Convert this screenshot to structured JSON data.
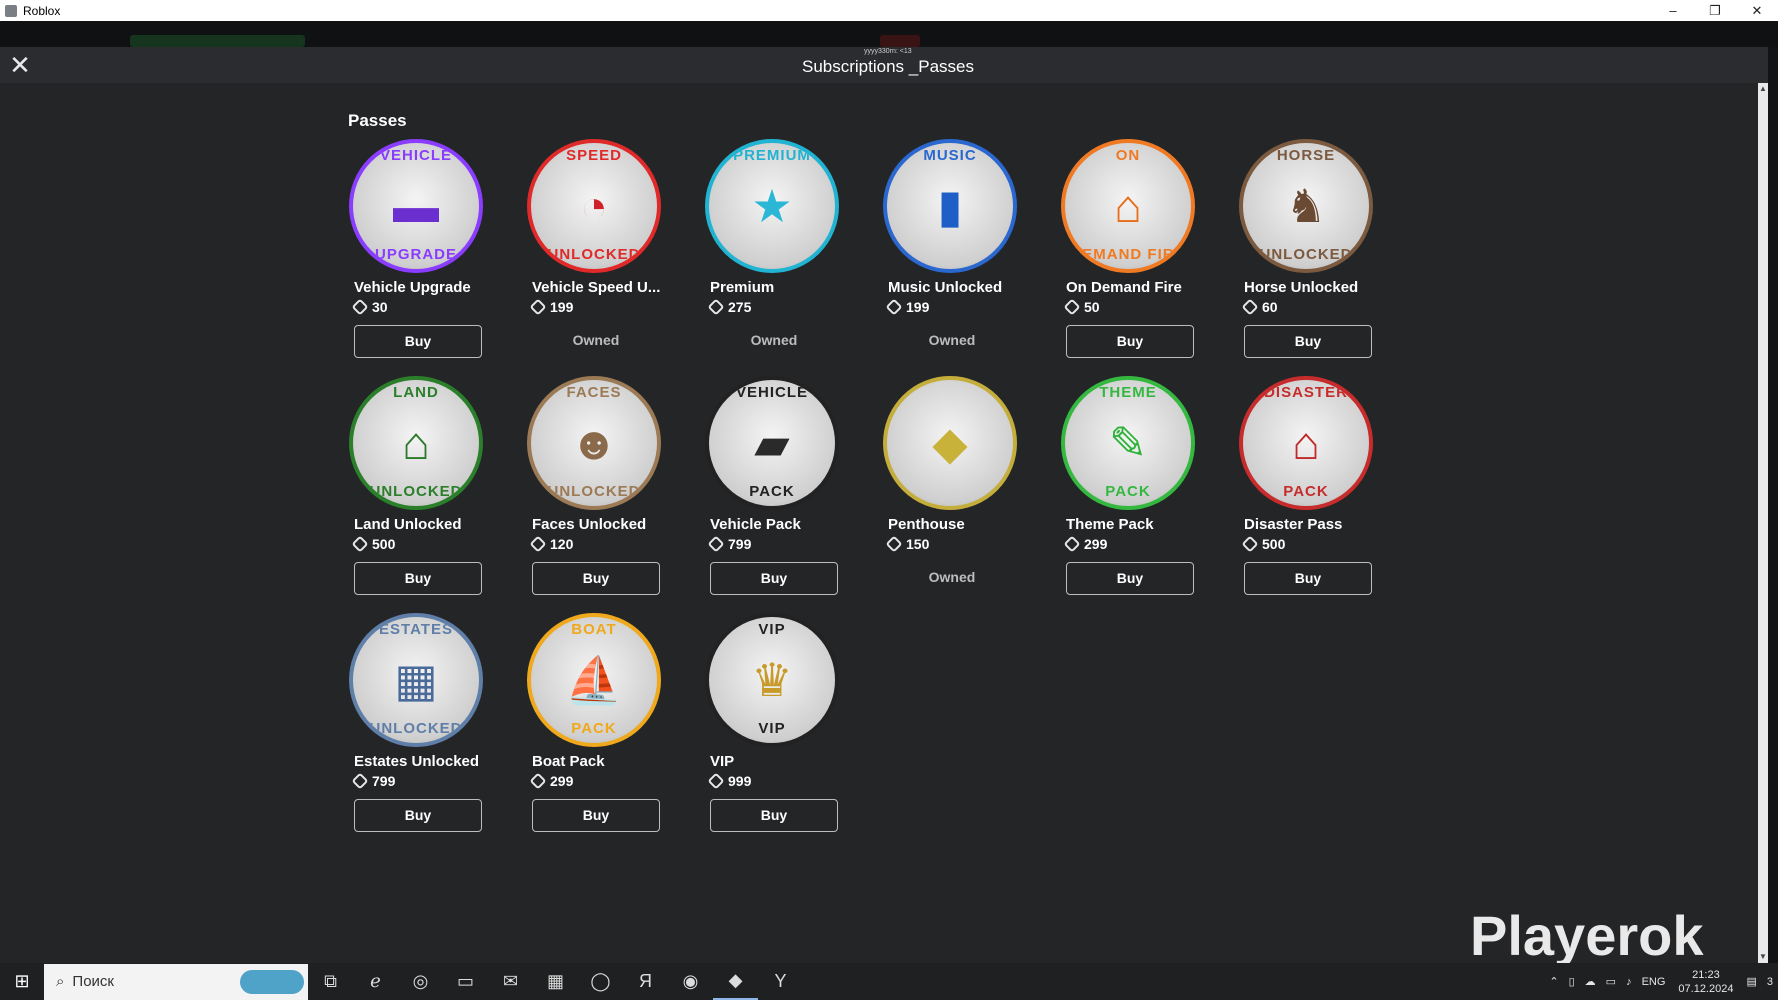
{
  "window": {
    "title": "Roblox",
    "minimize": "–",
    "restore": "❐",
    "close": "✕"
  },
  "panel": {
    "user_label": "yyyy330rn: <13",
    "title": "Subscriptions _Passes",
    "close_glyph": "✕",
    "section_title": "Passes"
  },
  "passes": [
    {
      "name": "Vehicle Upgrade",
      "price": "30",
      "action": "Buy",
      "owned": false,
      "ring_top": "VEHICLE",
      "ring_bottom": "UPGRADE",
      "glyph": "▬",
      "accent": "#6b2fd0",
      "ring_color": "#8a3cff"
    },
    {
      "name": "Vehicle Speed U...",
      "price": "199",
      "action": "Owned",
      "owned": true,
      "ring_top": "SPEED",
      "ring_bottom": "UNLOCKED",
      "glyph": "◔",
      "accent": "#d0202a",
      "ring_color": "#e02a2a"
    },
    {
      "name": "Premium",
      "price": "275",
      "action": "Owned",
      "owned": true,
      "ring_top": "PREMIUM",
      "ring_bottom": "",
      "glyph": "★",
      "accent": "#2ab7d6",
      "ring_color": "#21b3d2"
    },
    {
      "name": "Music Unlocked",
      "price": "199",
      "action": "Owned",
      "owned": true,
      "ring_top": "MUSIC",
      "ring_bottom": "",
      "glyph": "▮",
      "accent": "#1e5fc7",
      "ring_color": "#2a67cf"
    },
    {
      "name": "On Demand Fire",
      "price": "50",
      "action": "Buy",
      "owned": false,
      "ring_top": "ON",
      "ring_bottom": "DEMAND FIRE",
      "glyph": "⌂",
      "accent": "#e86d1a",
      "ring_color": "#f07a23"
    },
    {
      "name": "Horse Unlocked",
      "price": "60",
      "action": "Buy",
      "owned": false,
      "ring_top": "HORSE",
      "ring_bottom": "UNLOCKED",
      "glyph": "♞",
      "accent": "#6a4a33",
      "ring_color": "#7c5a3f"
    },
    {
      "name": "Land Unlocked",
      "price": "500",
      "action": "Buy",
      "owned": false,
      "ring_top": "LAND",
      "ring_bottom": "UNLOCKED",
      "glyph": "⌂",
      "accent": "#2a7a2a",
      "ring_color": "#2b7f2b"
    },
    {
      "name": "Faces Unlocked",
      "price": "120",
      "action": "Buy",
      "owned": false,
      "ring_top": "FACES",
      "ring_bottom": "UNLOCKED",
      "glyph": "☻",
      "accent": "#8a6a4a",
      "ring_color": "#9b7a55"
    },
    {
      "name": "Vehicle Pack",
      "price": "799",
      "action": "Buy",
      "owned": false,
      "ring_top": "VEHICLE",
      "ring_bottom": "PACK",
      "glyph": "▰",
      "accent": "#2a2a2a",
      "ring_color": "#222222"
    },
    {
      "name": "Penthouse",
      "price": "150",
      "action": "Owned",
      "owned": true,
      "ring_top": "",
      "ring_bottom": "",
      "glyph": "◆",
      "accent": "#c9b23a",
      "ring_color": "#c4ad3a"
    },
    {
      "name": "Theme Pack",
      "price": "299",
      "action": "Buy",
      "owned": false,
      "ring_top": "THEME",
      "ring_bottom": "PACK",
      "glyph": "✎",
      "accent": "#2fb23a",
      "ring_color": "#35b840"
    },
    {
      "name": "Disaster Pass",
      "price": "500",
      "action": "Buy",
      "owned": false,
      "ring_top": "DISASTER",
      "ring_bottom": "PACK",
      "glyph": "⌂",
      "accent": "#c02a2a",
      "ring_color": "#c72c2c"
    },
    {
      "name": "Estates Unlocked",
      "price": "799",
      "action": "Buy",
      "owned": false,
      "ring_top": "ESTATES",
      "ring_bottom": "UNLOCKED",
      "glyph": "▦",
      "accent": "#4a6b9a",
      "ring_color": "#5f7fa8"
    },
    {
      "name": "Boat Pack",
      "price": "299",
      "action": "Buy",
      "owned": false,
      "ring_top": "BOAT",
      "ring_bottom": "PACK",
      "glyph": "⛵",
      "accent": "#e3a21a",
      "ring_color": "#f0a81c"
    },
    {
      "name": "VIP",
      "price": "999",
      "action": "Buy",
      "owned": false,
      "ring_top": "VIP",
      "ring_bottom": "VIP",
      "glyph": "♛",
      "accent": "#c89a2a",
      "ring_color": "#222222"
    }
  ],
  "watermark": "Playerok",
  "taskbar": {
    "search_placeholder": "Поиск",
    "language": "ENG",
    "time": "21:23",
    "date": "07.12.2024",
    "notification_count": "3"
  }
}
